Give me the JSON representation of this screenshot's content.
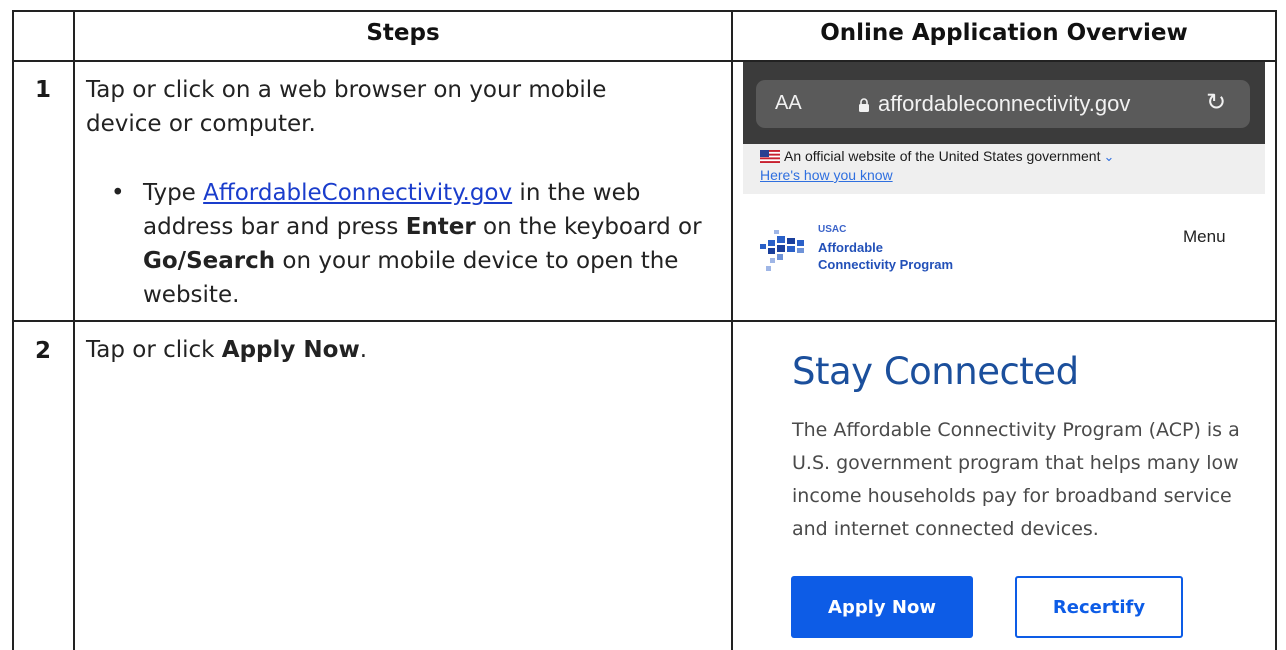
{
  "table": {
    "headers": {
      "steps": "Steps",
      "overview": "Online Application Overview"
    },
    "rows": [
      {
        "number": "1",
        "intro": "Tap or click on a web browser on your mobile device or computer.",
        "bullet_prefix": "Type ",
        "bullet_link": "AffordableConnectivity.gov",
        "bullet_mid": " in the web address bar and press ",
        "bullet_bold1": "Enter",
        "bullet_mid2": " on the keyboard or ",
        "bullet_bold2": "Go/Search",
        "bullet_end": " on your mobile device to open the website."
      },
      {
        "number": "2",
        "prefix": "Tap or click ",
        "bold": "Apply Now",
        "suffix": "."
      }
    ]
  },
  "browser": {
    "text_size_label": "AA",
    "url": "affordableconnectivity.gov",
    "reload_icon": "reload-icon"
  },
  "gov_banner": {
    "text": "An official website of the United States government",
    "link": "Here's how you know"
  },
  "site_header": {
    "logo_top": "USAC",
    "logo_line1": "Affordable",
    "logo_line2": "Connectivity Program",
    "menu": "Menu"
  },
  "hero": {
    "title": "Stay Connected",
    "paragraph": "The Affordable Connectivity Program (ACP) is a U.S. government program that helps many low income households pay for broadband service and internet connected devices.",
    "apply_button": "Apply Now",
    "recertify_button": "Recertify"
  },
  "colors": {
    "primary_blue": "#0d5ce6",
    "title_blue": "#1b4f9c",
    "link_blue": "#1a3dcc"
  }
}
